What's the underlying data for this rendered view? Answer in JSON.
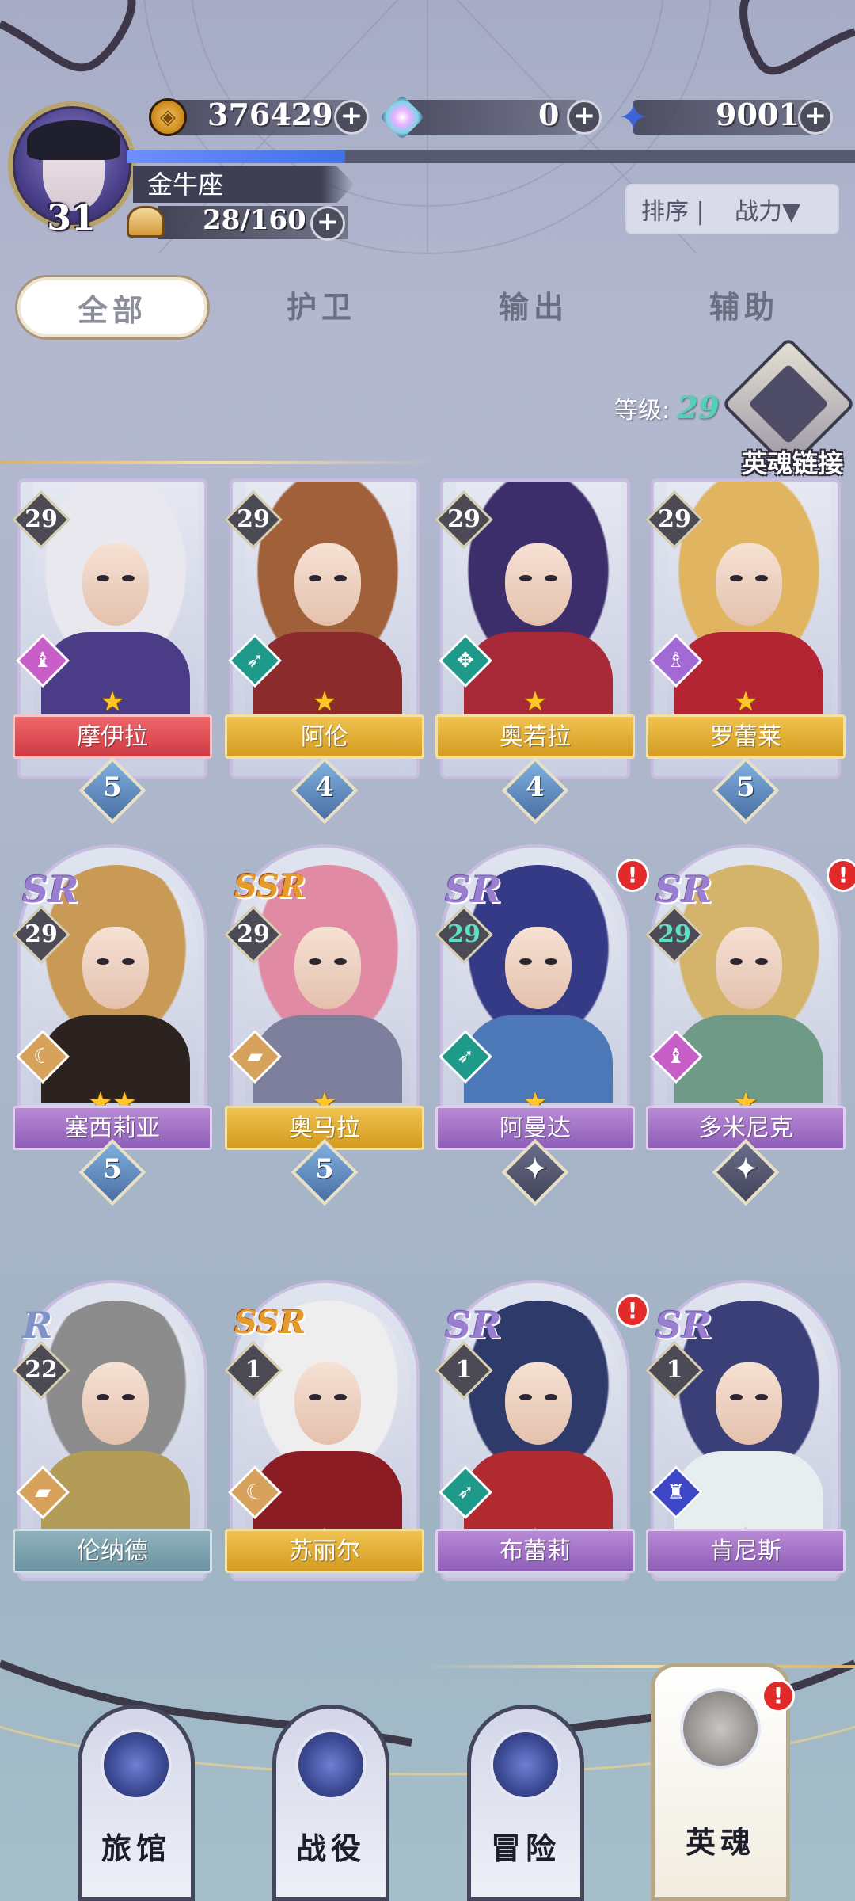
{
  "player": {
    "level": "31",
    "name": "金牛座",
    "stamina": "28/160",
    "exp_fraction": 0.3
  },
  "resources": {
    "gold": "376429",
    "gems": "0",
    "stars": "9001"
  },
  "sort": {
    "label": "排序",
    "value": "战力▼"
  },
  "tabs": [
    {
      "label": "全部",
      "active": true
    },
    {
      "label": "护卫"
    },
    {
      "label": "输出"
    },
    {
      "label": "辅助"
    }
  ],
  "level_filter": {
    "label": "等级:",
    "value": "29"
  },
  "soul_link": {
    "label": "英魂链接"
  },
  "heroes": [
    {
      "name": "摩伊拉",
      "level": "29",
      "stars": "★",
      "rank": "5",
      "ribbon": "red",
      "cls": "cls-pink",
      "cls_icon": "♝",
      "hair": "#e8e8ee",
      "outfit": "#4a3c86"
    },
    {
      "name": "阿伦",
      "level": "29",
      "stars": "★",
      "rank": "4",
      "ribbon": "gold",
      "cls": "cls-teal",
      "cls_icon": "➶",
      "hair": "#a0603a",
      "outfit": "#8c2b2b"
    },
    {
      "name": "奥若拉",
      "level": "29",
      "stars": "★",
      "rank": "4",
      "ribbon": "gold",
      "cls": "cls-teal",
      "cls_icon": "✥",
      "hair": "#3c2e6a",
      "outfit": "#a82a38"
    },
    {
      "name": "罗蕾莱",
      "level": "29",
      "stars": "★",
      "rank": "5",
      "ribbon": "gold",
      "cls": "cls-purple",
      "cls_icon": "♗",
      "hair": "#e0b460",
      "outfit": "#b32532"
    },
    {
      "name": "塞西莉亚",
      "level": "29",
      "rarity": "SR",
      "stars": "★★",
      "rank": "5",
      "ribbon": "purple",
      "cls": "cls-orange",
      "cls_icon": "☾",
      "hair": "#c89a56",
      "outfit": "#2c2320"
    },
    {
      "name": "奥马拉",
      "level": "29",
      "rarity": "SSR",
      "stars": "★",
      "rank": "5",
      "ribbon": "gold",
      "cls": "cls-orange",
      "cls_icon": "▰",
      "hair": "#e08aa4",
      "outfit": "#7e7f9c"
    },
    {
      "name": "阿曼达",
      "level": "29",
      "rarity": "SR",
      "stars": "★",
      "rank": "",
      "ribbon": "purple",
      "cls": "cls-teal",
      "cls_icon": "➶",
      "hair": "#353a86",
      "outfit": "#4c78b8",
      "alert": true
    },
    {
      "name": "多米尼克",
      "level": "29",
      "rarity": "SR",
      "stars": "★",
      "rank": "",
      "ribbon": "purple",
      "cls": "cls-pink",
      "cls_icon": "♝",
      "hair": "#d4b46a",
      "outfit": "#6f9a88",
      "alert": true
    },
    {
      "name": "伦纳德",
      "level": "22",
      "rarity": "R",
      "stars": "★",
      "ribbon": "teal",
      "cls": "cls-orange",
      "cls_icon": "▰",
      "hair": "#8c8c8c",
      "outfit": "#b39b58"
    },
    {
      "name": "苏丽尔",
      "level": "1",
      "rarity": "SSR",
      "stars": "★",
      "ribbon": "gold",
      "cls": "cls-orange",
      "cls_icon": "☾",
      "hair": "#eeeeee",
      "outfit": "#8c1c24"
    },
    {
      "name": "布蕾莉",
      "level": "1",
      "rarity": "SR",
      "stars": "★",
      "ribbon": "purple",
      "cls": "cls-teal",
      "cls_icon": "➶",
      "hair": "#2d3a6a",
      "outfit": "#b02a30",
      "alert": true
    },
    {
      "name": "肯尼斯",
      "level": "1",
      "rarity": "SR",
      "stars": "★",
      "ribbon": "purple",
      "cls": "cls-blue",
      "cls_icon": "♜",
      "hair": "#3a3f78",
      "outfit": "#e6eef0"
    }
  ],
  "nav": [
    {
      "label": "旅馆"
    },
    {
      "label": "战役"
    },
    {
      "label": "冒险"
    },
    {
      "label": "英魂",
      "active": true,
      "alert": true
    }
  ],
  "colors": {
    "gold_star": "#ffc52b",
    "alert_red": "#e22a2a",
    "level_teal": "#4fd2b5"
  }
}
